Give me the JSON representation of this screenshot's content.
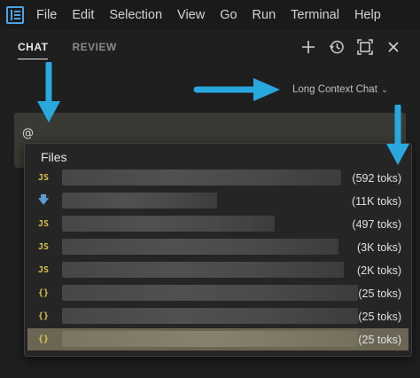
{
  "menubar": {
    "items": [
      "File",
      "Edit",
      "Selection",
      "View",
      "Go",
      "Run",
      "Terminal",
      "Help"
    ]
  },
  "panel": {
    "tabs": [
      {
        "label": "CHAT",
        "active": true
      },
      {
        "label": "REVIEW",
        "active": false
      }
    ],
    "actions": [
      "plus-icon",
      "history-icon",
      "maximize-icon",
      "close-icon"
    ],
    "model_selector": {
      "label": "Long Context Chat"
    }
  },
  "chat_input": {
    "value": "@"
  },
  "dropdown": {
    "title": "Files",
    "items": [
      {
        "icon": "JS",
        "tokens": "(592 toks)",
        "selected": false
      },
      {
        "icon": "arrow-down",
        "tokens": "(11K toks)",
        "selected": false
      },
      {
        "icon": "JS",
        "tokens": "(497 toks)",
        "selected": false
      },
      {
        "icon": "JS",
        "tokens": "(3K toks)",
        "selected": false
      },
      {
        "icon": "JS",
        "tokens": "(2K toks)",
        "selected": false
      },
      {
        "icon": "{}",
        "tokens": "(25 toks)",
        "selected": false
      },
      {
        "icon": "{}",
        "tokens": "(25 toks)",
        "selected": false
      },
      {
        "icon": "{}",
        "tokens": "(25 toks)",
        "selected": true
      }
    ]
  },
  "colors": {
    "accent_arrow": "#29a8e0",
    "js_icon": "#d8c44a",
    "selected_row": "#6b6654"
  }
}
